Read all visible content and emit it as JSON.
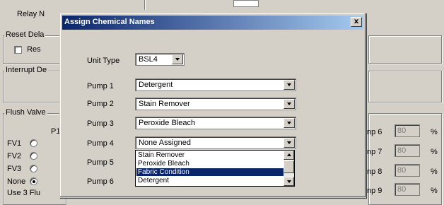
{
  "background": {
    "relay_label": "Relay N",
    "reset_group_title": "Reset Dela",
    "reset_checkbox_label": "Res",
    "interrupt_group_title": "Interrupt De",
    "flush_group_title": "Flush Valve",
    "p1_header": "P1",
    "flush_rows": [
      {
        "label": "FV1",
        "selected": false
      },
      {
        "label": "FV2",
        "selected": false
      },
      {
        "label": "FV3",
        "selected": false
      },
      {
        "label": "None",
        "selected": true
      }
    ],
    "use_label": "Use 3 Flu",
    "pump_rows": [
      {
        "label": "np 6",
        "value": "80",
        "unit": "%"
      },
      {
        "label": "np 7",
        "value": "80",
        "unit": "%"
      },
      {
        "label": "np 8",
        "value": "80",
        "unit": "%"
      },
      {
        "label": "np 9",
        "value": "80",
        "unit": "%"
      }
    ]
  },
  "dialog": {
    "title": "Assign Chemical Names",
    "close_glyph": "x",
    "unit_type": {
      "label": "Unit Type",
      "value": "BSL4"
    },
    "pumps": [
      {
        "label": "Pump 1",
        "value": "Detergent"
      },
      {
        "label": "Pump 2",
        "value": "Stain Remover"
      },
      {
        "label": "Pump 3",
        "value": "Peroxide Bleach"
      },
      {
        "label": "Pump 4",
        "value": "None Assigned"
      },
      {
        "label": "Pump 5",
        "value": ""
      },
      {
        "label": "Pump 6",
        "value": ""
      }
    ],
    "dropdown_options": [
      {
        "label": "Stain Remover",
        "selected": false
      },
      {
        "label": "Peroxide Bleach",
        "selected": false
      },
      {
        "label": "Fabric Condition",
        "selected": true
      },
      {
        "label": "Detergent",
        "selected": false
      }
    ]
  }
}
